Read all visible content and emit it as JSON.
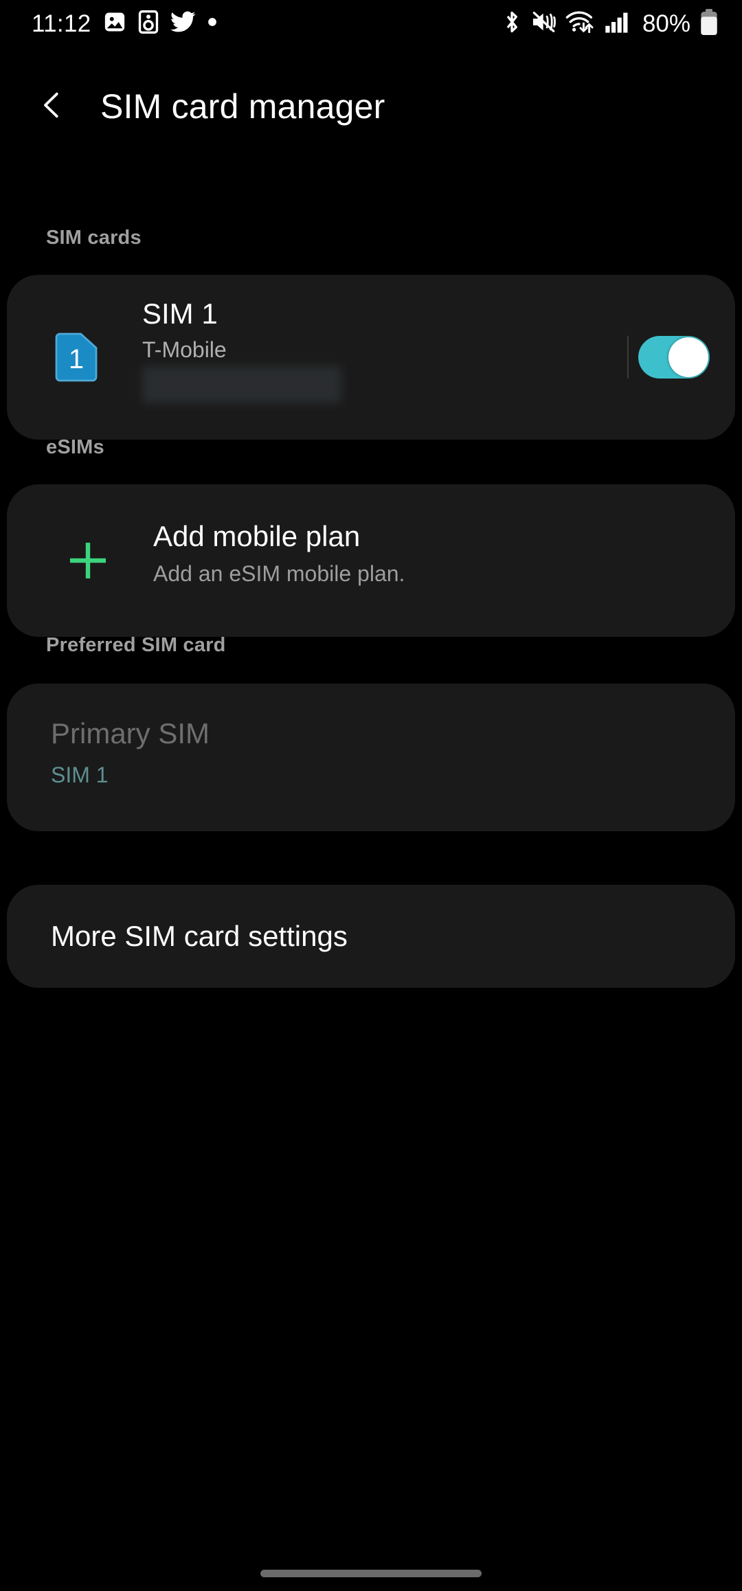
{
  "status_bar": {
    "time": "11:12",
    "battery_percent": "80%",
    "left_icons": [
      "photo-icon",
      "speaker-icon",
      "twitter-icon",
      "dot-icon"
    ],
    "right_icons": [
      "bluetooth-icon",
      "mute-icon",
      "wifi-icon",
      "signal-icon",
      "battery-icon"
    ]
  },
  "header": {
    "title": "SIM card manager",
    "back_icon": "chevron-left-icon"
  },
  "sections": {
    "sim_cards": {
      "label": "SIM cards",
      "item": {
        "badge_number": "1",
        "title": "SIM 1",
        "subtitle": "T-Mobile",
        "phone_number_redacted": "",
        "toggle_state": "on",
        "toggle_color": "#3ec0cc",
        "badge_color": "#1a8bc4"
      }
    },
    "esims": {
      "label": "eSIMs",
      "item": {
        "icon": "plus-icon",
        "icon_color": "#3dd47e",
        "title": "Add mobile plan",
        "subtitle": "Add an eSIM mobile plan."
      }
    },
    "preferred_sim_card": {
      "label": "Preferred SIM card",
      "item": {
        "title": "Primary SIM",
        "value": "SIM 1"
      }
    },
    "more_settings": {
      "label": "More SIM card settings"
    }
  },
  "nav_bar": {
    "home_indicator": "home-gesture-pill"
  }
}
